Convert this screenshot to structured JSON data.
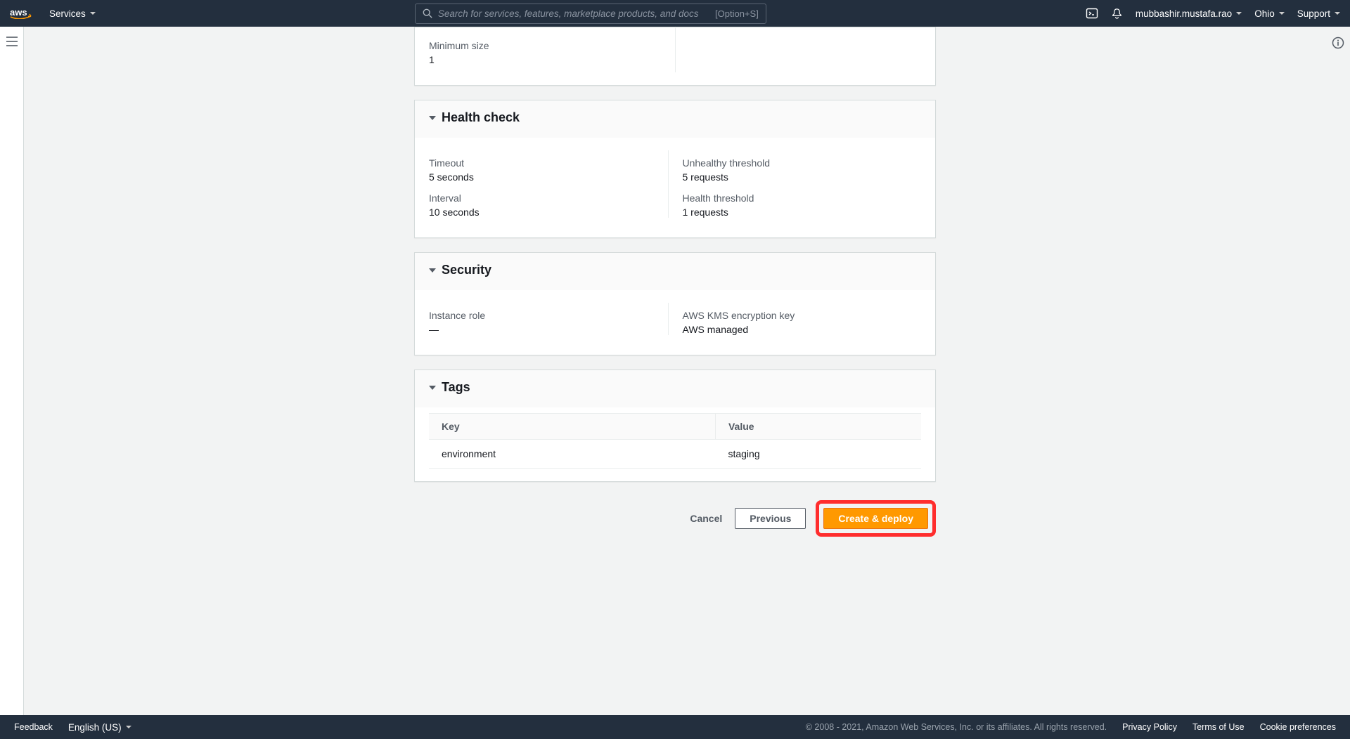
{
  "nav": {
    "services_label": "Services",
    "search_placeholder": "Search for services, features, marketplace products, and docs",
    "search_shortcut": "[Option+S]",
    "username": "mubbashir.mustafa.rao",
    "region": "Ohio",
    "support": "Support"
  },
  "partial_card": {
    "min_size_label": "Minimum size",
    "min_size_value": "1"
  },
  "health_check": {
    "title": "Health check",
    "timeout_label": "Timeout",
    "timeout_value": "5 seconds",
    "interval_label": "Interval",
    "interval_value": "10 seconds",
    "unhealthy_label": "Unhealthy threshold",
    "unhealthy_value": "5 requests",
    "healthy_label": "Health threshold",
    "healthy_value": "1 requests"
  },
  "security": {
    "title": "Security",
    "instance_role_label": "Instance role",
    "instance_role_value": "—",
    "kms_label": "AWS KMS encryption key",
    "kms_value": "AWS managed"
  },
  "tags": {
    "title": "Tags",
    "key_header": "Key",
    "value_header": "Value",
    "rows": [
      {
        "key": "environment",
        "value": "staging"
      }
    ]
  },
  "actions": {
    "cancel": "Cancel",
    "previous": "Previous",
    "create": "Create & deploy"
  },
  "footer": {
    "feedback": "Feedback",
    "language": "English (US)",
    "copyright": "© 2008 - 2021, Amazon Web Services, Inc. or its affiliates. All rights reserved.",
    "privacy": "Privacy Policy",
    "terms": "Terms of Use",
    "cookies": "Cookie preferences"
  }
}
